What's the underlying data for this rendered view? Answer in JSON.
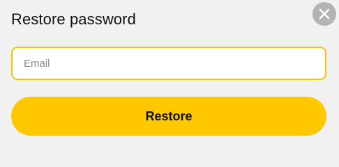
{
  "dialog": {
    "title": "Restore password",
    "close_icon": "close-icon",
    "email": {
      "placeholder": "Email",
      "value": ""
    },
    "restore_label": "Restore"
  },
  "colors": {
    "background": "#f1f1f1",
    "accent": "#ffc800",
    "input_border": "#f6c400",
    "close_circle": "#b3b3b3"
  }
}
